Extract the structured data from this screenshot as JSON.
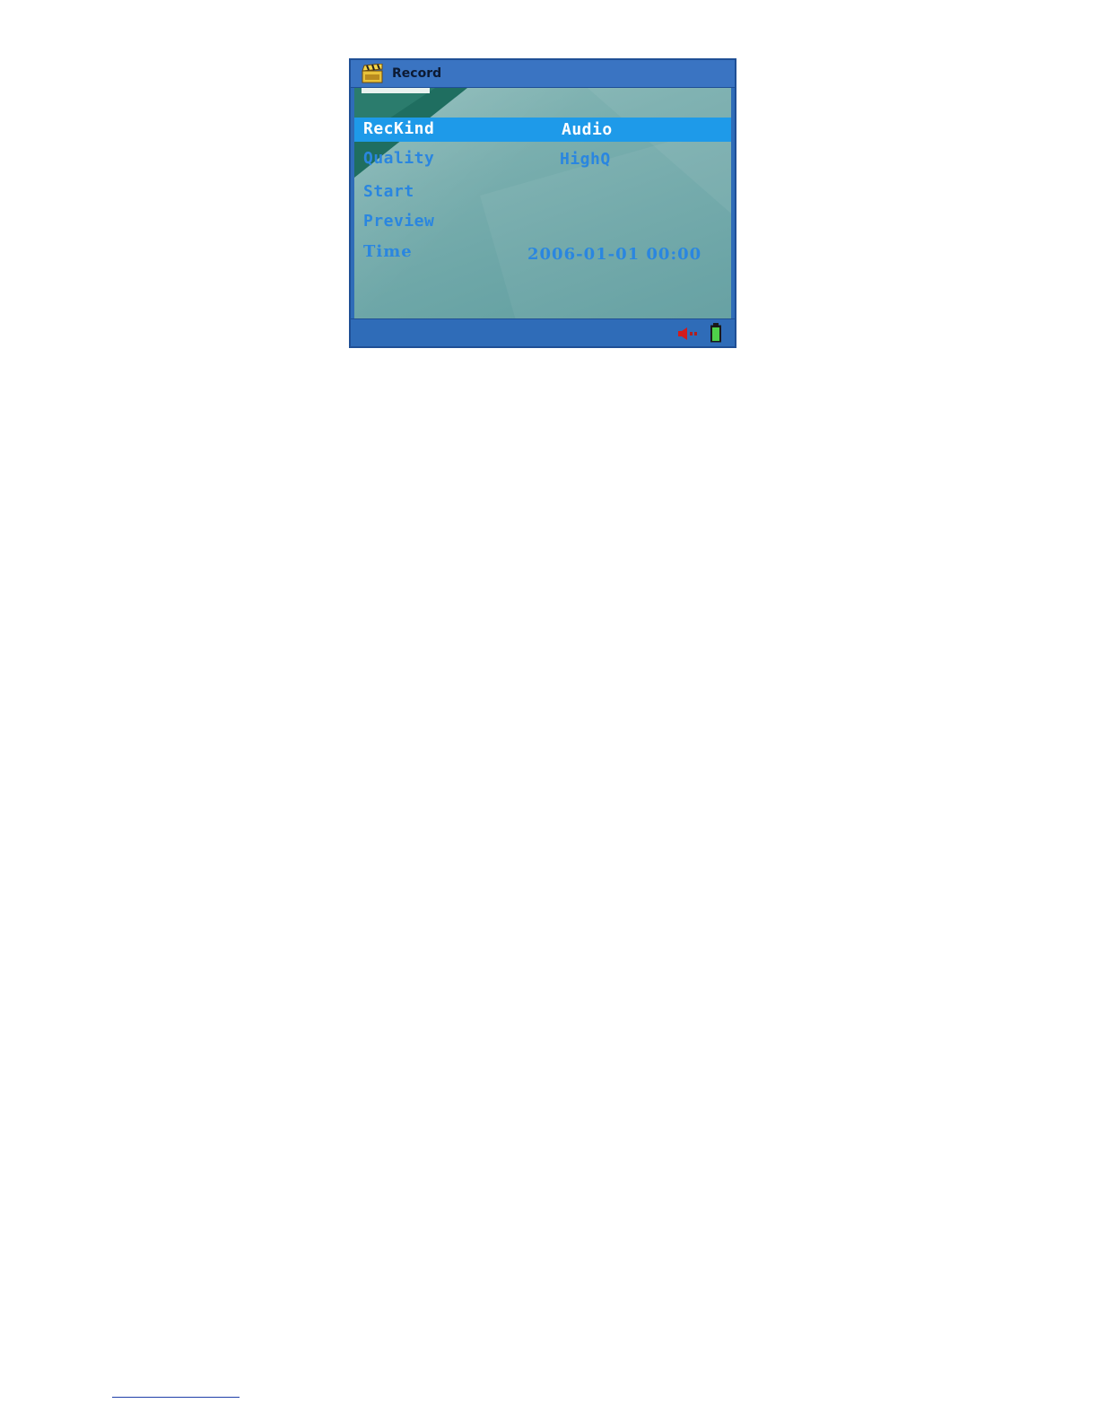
{
  "window": {
    "title": "Record",
    "title_icon": "clapperboard-icon"
  },
  "menu": {
    "items": [
      {
        "label": "RecKind",
        "value": "Audio",
        "selected": true
      },
      {
        "label": "Quality",
        "value": "HighQ",
        "selected": false
      },
      {
        "label": "Start",
        "value": "",
        "selected": false
      },
      {
        "label": "Preview",
        "value": "",
        "selected": false
      },
      {
        "label": "Time",
        "value": "2006-01-01 00:00",
        "selected": false
      }
    ]
  },
  "status_bar": {
    "icons": [
      "speaker-icon",
      "battery-icon"
    ]
  },
  "colors": {
    "frame": "#2f6cb8",
    "highlight": "#1e9ae9",
    "text": "#2a86e0",
    "panel": "#79aeae"
  }
}
